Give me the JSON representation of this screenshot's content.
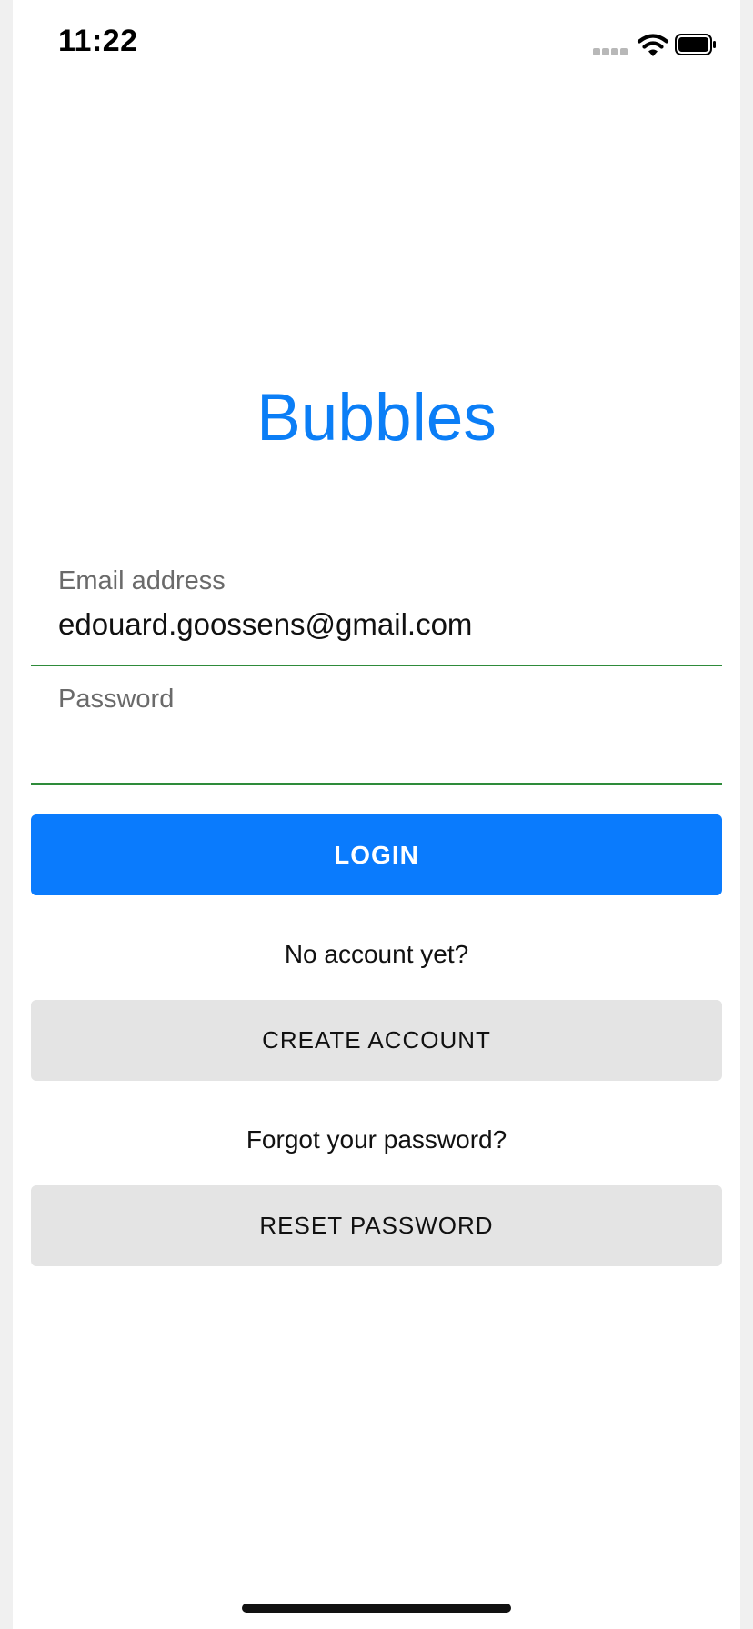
{
  "status_bar": {
    "time": "11:22"
  },
  "app": {
    "title": "Bubbles"
  },
  "form": {
    "email": {
      "label": "Email address",
      "value": "edouard.goossens@gmail.com"
    },
    "password": {
      "label": "Password",
      "value": ""
    },
    "login_label": "LOGIN",
    "no_account_text": "No account yet?",
    "create_account_label": "CREATE ACCOUNT",
    "forgot_text": "Forgot your password?",
    "reset_label": "RESET PASSWORD"
  },
  "colors": {
    "accent": "#0a7bfd",
    "title": "#0b7ef6",
    "field_underline": "#2e8b3a",
    "secondary_button": "#e4e4e4"
  },
  "icons": [
    "cellular-signal-icon",
    "wifi-icon",
    "battery-icon"
  ]
}
